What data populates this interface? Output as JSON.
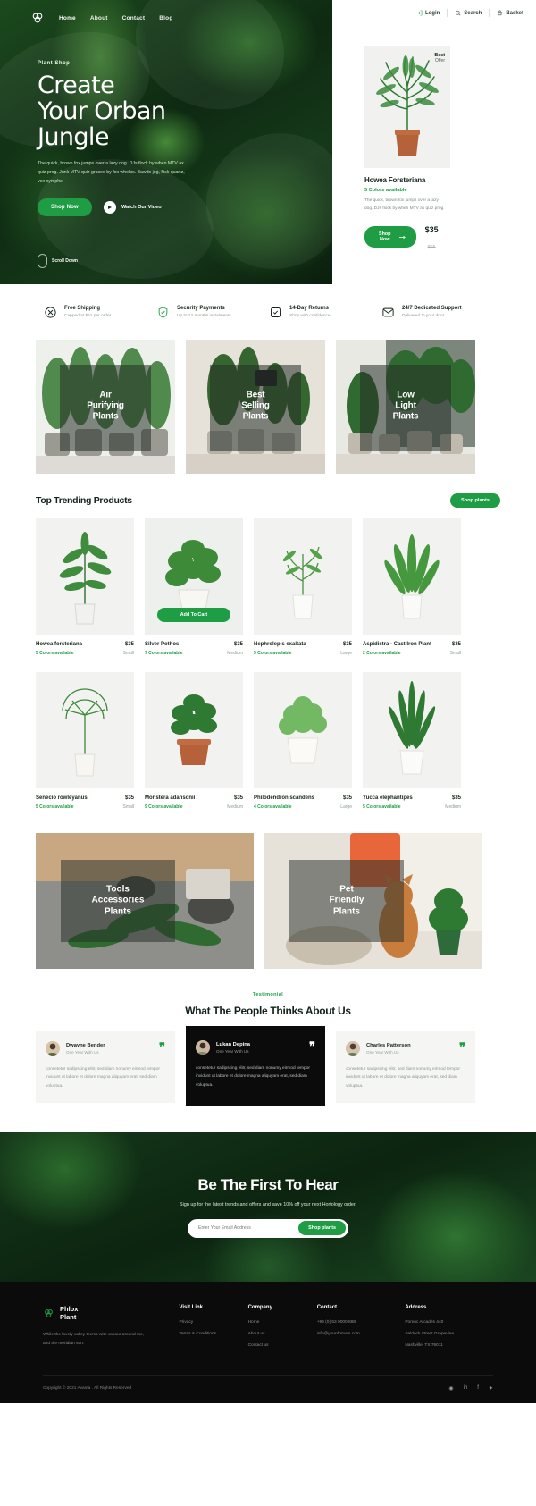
{
  "header": {
    "logo_name": "plant-logo",
    "nav": [
      {
        "label": "Home",
        "active": true
      },
      {
        "label": "About",
        "active": false
      },
      {
        "label": "Contact",
        "active": false
      },
      {
        "label": "Blog",
        "active": false
      }
    ],
    "utility": [
      {
        "label": "Login",
        "icon": "user-icon"
      },
      {
        "label": "Search",
        "icon": "search-icon"
      },
      {
        "label": "Basket",
        "icon": "basket-icon"
      }
    ]
  },
  "hero": {
    "eyebrow": "Plant Shop",
    "title_line1": "Create",
    "title_line2": "Your Orban",
    "title_line3": "Jungle",
    "paragraph": "The quick, brown fox jumps over a lazy dog. DJs flock by when MTV ax quiz prog. Junk MTV quiz graced by fox whelps. Bawds jog, flick quartz, vex nymphs.",
    "shop_button": "Shop Now",
    "video_label": "Watch Our Video",
    "scroll_label": "Scroll Down"
  },
  "hero_card": {
    "badge_line1": "Best",
    "badge_line2": "Offer",
    "title": "Howea Forsteriana",
    "colors": "5 Colors available",
    "description": "The quick, brown fox jumps over a lazy dog. DJs flock by when MTV ax quiz prog.",
    "button": "Shop Now",
    "price": "$35",
    "old_price": "$55"
  },
  "features": [
    {
      "icon": "shipping-icon",
      "title": "Free Shipping",
      "sub": "Capped at $51 per order"
    },
    {
      "icon": "shield-icon",
      "title": "Security Payments",
      "sub": "Up to 12 months instalments"
    },
    {
      "icon": "return-icon",
      "title": "14-Day Returns",
      "sub": "Shop with confidence"
    },
    {
      "icon": "support-icon",
      "title": "24/7 Dedicated Support",
      "sub": "Delivered to your door"
    }
  ],
  "categories": [
    {
      "label": "Air\nPurifying\nPlants",
      "name": "air-purifying-plants"
    },
    {
      "label": "Best\nSelling\nPlants",
      "name": "best-selling-plants"
    },
    {
      "label": "Low\nLight\nPlants",
      "name": "low-light-plants"
    }
  ],
  "trending": {
    "title": "Top Trending Products",
    "button": "Shop plants",
    "add_to_cart": "Add To Cart",
    "products": [
      {
        "name": "Howea forsteriana",
        "price": "$35",
        "colors": "5 Colors available",
        "size": "Small",
        "featured": false
      },
      {
        "name": "Silver Pothos",
        "price": "$35",
        "colors": "7 Colors available",
        "size": "Medium",
        "featured": true
      },
      {
        "name": "Nephrolepis exaltata",
        "price": "$35",
        "colors": "5 Colors available",
        "size": "Large",
        "featured": false
      },
      {
        "name": "Aspidistra - Cast Iron Plant",
        "price": "$35",
        "colors": "2 Colors available",
        "size": "Small",
        "featured": false
      },
      {
        "name": "Senecio rowleyanus",
        "price": "$35",
        "colors": "5 Colors available",
        "size": "Small",
        "featured": false
      },
      {
        "name": "Monstera adansonii",
        "price": "$35",
        "colors": "9 Colors available",
        "size": "Medium",
        "featured": false
      },
      {
        "name": "Philodendron scandens",
        "price": "$35",
        "colors": "4 Colors available",
        "size": "Large",
        "featured": false
      },
      {
        "name": "Yucca elephantipes",
        "price": "$35",
        "colors": "5 Colors available",
        "size": "Medium",
        "featured": false
      }
    ]
  },
  "banners": [
    {
      "label": "Tools\nAccessories\nPlants",
      "name": "tools-accessories-plants"
    },
    {
      "label": "Pet\nFriendly\nPlants",
      "name": "pet-friendly-plants"
    }
  ],
  "testimonial": {
    "eyebrow": "Testimonial",
    "title": "What The People Thinks About Us",
    "cards": [
      {
        "name": "Dwayne Bender",
        "role": "One Year With Us",
        "body": "consetetur sadipscing elitr, sed diam nonumy eirmod tempor invidunt ut labore et dolore magna aliquyam erat, sed diam voluptua.",
        "dark": false
      },
      {
        "name": "Lukan Depina",
        "role": "One Year With Us",
        "body": "consetetur sadipscing elitr, sed diam nonumy eirmod tempor invidunt ut labore et dolore magna aliquyam erat, sed diam voluptua.",
        "dark": true
      },
      {
        "name": "Charles Patterson",
        "role": "One Year With Us",
        "body": "consetetur sadipscing elitr, sed diam nonumy eirmod tempor invidunt ut labore et dolore magna aliquyam erat, sed diam voluptua.",
        "dark": false
      }
    ]
  },
  "newsletter": {
    "title": "Be The First To Hear",
    "subtitle": "Sign up for the latest trends and offers and save 10% off your next Hortology order.",
    "placeholder": "Enter Your Email Address",
    "button": "Shop plants"
  },
  "footer": {
    "brand_line1": "Phlox",
    "brand_line2": "Plant",
    "description": "While the lovely valley teems with vapour around me, and the meridian sun.",
    "columns": [
      {
        "heading": "Visit Link",
        "items": [
          "Privacy",
          "Terms & Conditions"
        ]
      },
      {
        "heading": "Company",
        "items": [
          "Home",
          "About us",
          "Contact us"
        ]
      },
      {
        "heading": "Contact",
        "items": [
          "+99 (0) 53 0000 888",
          "info@yourdomain.com"
        ]
      },
      {
        "heading": "Address",
        "items": [
          "Pomoc Arcades 440",
          "Seldeck Street Grapevine",
          "Nashville, TX 76011"
        ]
      }
    ],
    "copyright": "Copyright © 2021 Avanta . All Rights Reserved",
    "social": [
      "instagram-icon",
      "linkedin-icon",
      "facebook-icon",
      "twitter-icon"
    ]
  },
  "colors": {
    "accent": "#1f9d44",
    "dark": "#0b0b0b",
    "text": "#14251a"
  }
}
